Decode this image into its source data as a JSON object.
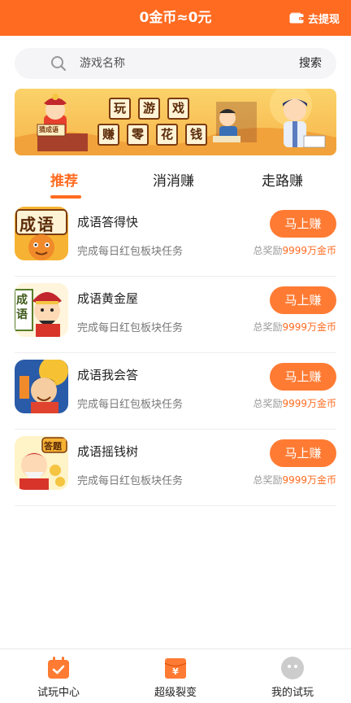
{
  "header": {
    "title": "0金币≈0元",
    "withdraw_label": "去提现"
  },
  "search": {
    "placeholder": "游戏名称",
    "button_label": "搜索"
  },
  "banner": {
    "tiles": [
      "玩",
      "游",
      "戏",
      "赚",
      "零",
      "花",
      "钱"
    ],
    "badge": "猜成语"
  },
  "tabs": [
    {
      "label": "推荐",
      "active": true
    },
    {
      "label": "消消赚",
      "active": false
    },
    {
      "label": "走路赚",
      "active": false
    }
  ],
  "games": [
    {
      "name": "成语答得快",
      "task": "完成每日红包板块任务",
      "button": "马上赚",
      "reward_prefix": "总奖励",
      "reward_amount": "9999万金币",
      "icon": "chengyu-dadekuai-icon",
      "icon_text": "成语"
    },
    {
      "name": "成语黄金屋",
      "task": "完成每日红包板块任务",
      "button": "马上赚",
      "reward_prefix": "总奖励",
      "reward_amount": "9999万金币",
      "icon": "chengyu-huangjinwu-icon",
      "icon_text": "成语"
    },
    {
      "name": "成语我会答",
      "task": "完成每日红包板块任务",
      "button": "马上赚",
      "reward_prefix": "总奖励",
      "reward_amount": "9999万金币",
      "icon": "chengyu-wohuida-icon",
      "icon_text": ""
    },
    {
      "name": "成语摇钱树",
      "task": "完成每日红包板块任务",
      "button": "马上赚",
      "reward_prefix": "总奖励",
      "reward_amount": "9999万金币",
      "icon": "chengyu-yaoqianshu-icon",
      "icon_text": "答题"
    }
  ],
  "bottom_nav": [
    {
      "label": "试玩中心",
      "icon": "calendar-check-icon"
    },
    {
      "label": "超级裂变",
      "icon": "yuan-envelope-icon"
    },
    {
      "label": "我的试玩",
      "icon": "avatar-icon"
    }
  ],
  "colors": {
    "accent": "#FF6B21",
    "button": "#FF7B33"
  }
}
